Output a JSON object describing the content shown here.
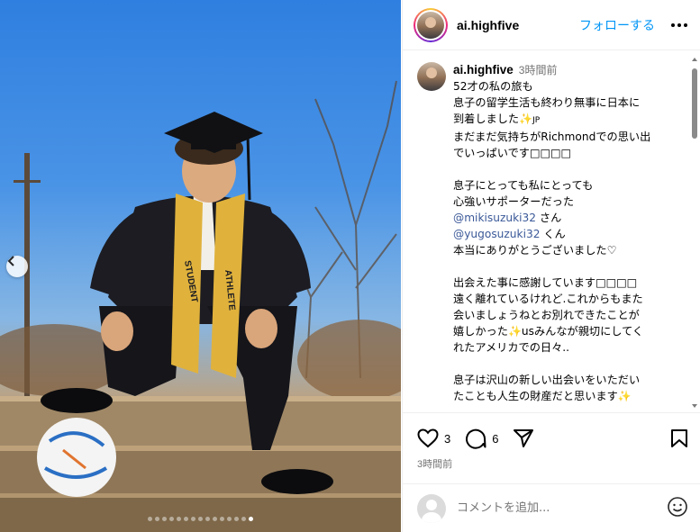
{
  "post": {
    "username": "ai.highfive",
    "follow_label": "フォローする",
    "more_icon": "more-horizontal-icon",
    "photo_count": 15,
    "active_photo_index": 14
  },
  "caption": {
    "username": "ai.highfive",
    "time": "3時間前",
    "lines": [
      "52才の私の旅も",
      "息子の留学生活も終わり無事に日本に",
      "到着しました",
      "まだまだ気持ちがRichmondでの思い出",
      "でいっぱいです",
      "息子にとっても私にとっても",
      "心強いサポーターだった",
      "@mikisuzuki32",
      "さん",
      "@yugosuzuki32",
      "くん",
      "本当にありがとうございました♡",
      "出会えた事に感謝しています",
      "遠く離れているけれど.これからもまた",
      "会いましょうねとお別れできたことが",
      "嬉しかった",
      "usみんなが親切にしてく",
      "れたアメリカでの日々..",
      "息子は沢山の新しい出会いをいただい",
      "たことも人生の財産だと思います"
    ],
    "jp_flag": "JP",
    "sparkle": "✨",
    "placeholder_boxes": "□□□□"
  },
  "actions": {
    "like_count": "3",
    "comment_count": "6",
    "posted_time": "3時間前"
  },
  "comment_box": {
    "placeholder": "コメントを追加..."
  },
  "colors": {
    "accent": "#0095f6",
    "mention": "#3b5998",
    "secondary_text": "#737373"
  }
}
